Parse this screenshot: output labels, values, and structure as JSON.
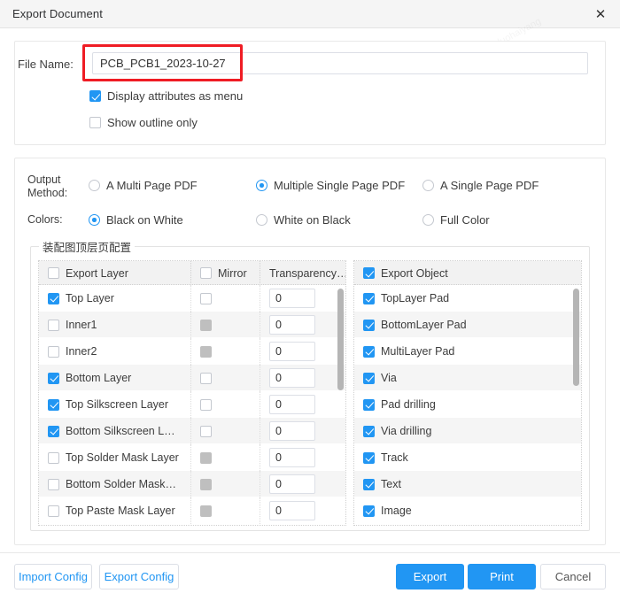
{
  "window": {
    "title": "Export Document",
    "close_icon": "close-icon"
  },
  "file": {
    "label": "File Name:",
    "value": "PCB_PCB1_2023-10-27",
    "placeholder": ""
  },
  "options": [
    {
      "label": "Display attributes as menu",
      "checked": true
    },
    {
      "label": "Show outline only",
      "checked": false
    }
  ],
  "output_method": {
    "label": "Output Method:",
    "options": [
      {
        "label": "A Multi Page PDF",
        "selected": false
      },
      {
        "label": "Multiple Single Page PDF",
        "selected": true
      },
      {
        "label": "A Single Page PDF",
        "selected": false
      }
    ]
  },
  "colors": {
    "label": "Colors:",
    "options": [
      {
        "label": "Black on White",
        "selected": true
      },
      {
        "label": "White on Black",
        "selected": false
      },
      {
        "label": "Full Color",
        "selected": false
      }
    ]
  },
  "group": {
    "legend": "装配图顶层页配置"
  },
  "layer_table": {
    "headers": [
      {
        "label": "Export Layer",
        "checked": false
      },
      {
        "label": "Mirror",
        "checked": false
      },
      {
        "label": "Transparency…"
      }
    ],
    "rows": [
      {
        "layer": "Top Layer",
        "export": true,
        "mirror": false,
        "mirror_disabled": false,
        "transparency": "0"
      },
      {
        "layer": "Inner1",
        "export": false,
        "mirror": false,
        "mirror_disabled": true,
        "transparency": "0"
      },
      {
        "layer": "Inner2",
        "export": false,
        "mirror": false,
        "mirror_disabled": true,
        "transparency": "0"
      },
      {
        "layer": "Bottom Layer",
        "export": true,
        "mirror": false,
        "mirror_disabled": false,
        "transparency": "0"
      },
      {
        "layer": "Top Silkscreen Layer",
        "export": true,
        "mirror": false,
        "mirror_disabled": false,
        "transparency": "0"
      },
      {
        "layer": "Bottom Silkscreen L…",
        "export": true,
        "mirror": false,
        "mirror_disabled": false,
        "transparency": "0"
      },
      {
        "layer": "Top Solder Mask Layer",
        "export": false,
        "mirror": false,
        "mirror_disabled": true,
        "transparency": "0"
      },
      {
        "layer": "Bottom Solder Mask…",
        "export": false,
        "mirror": false,
        "mirror_disabled": true,
        "transparency": "0"
      },
      {
        "layer": "Top Paste Mask Layer",
        "export": false,
        "mirror": false,
        "mirror_disabled": true,
        "transparency": "0"
      }
    ]
  },
  "object_table": {
    "header": {
      "label": "Export Object",
      "checked": true
    },
    "rows": [
      {
        "object": "TopLayer Pad",
        "checked": true
      },
      {
        "object": "BottomLayer Pad",
        "checked": true
      },
      {
        "object": "MultiLayer Pad",
        "checked": true
      },
      {
        "object": "Via",
        "checked": true
      },
      {
        "object": "Pad drilling",
        "checked": true
      },
      {
        "object": "Via drilling",
        "checked": true
      },
      {
        "object": "Track",
        "checked": true
      },
      {
        "object": "Text",
        "checked": true
      },
      {
        "object": "Image",
        "checked": true
      }
    ]
  },
  "footer": {
    "import_config": "Import Config",
    "export_config": "Export Config",
    "export": "Export",
    "print": "Print",
    "cancel": "Cancel"
  },
  "theme": {
    "accent": "#2196f3",
    "highlight": "#ef1c24"
  },
  "watermarks": [
    "luohaiyang",
    "2023-10-27",
    "14:40"
  ]
}
